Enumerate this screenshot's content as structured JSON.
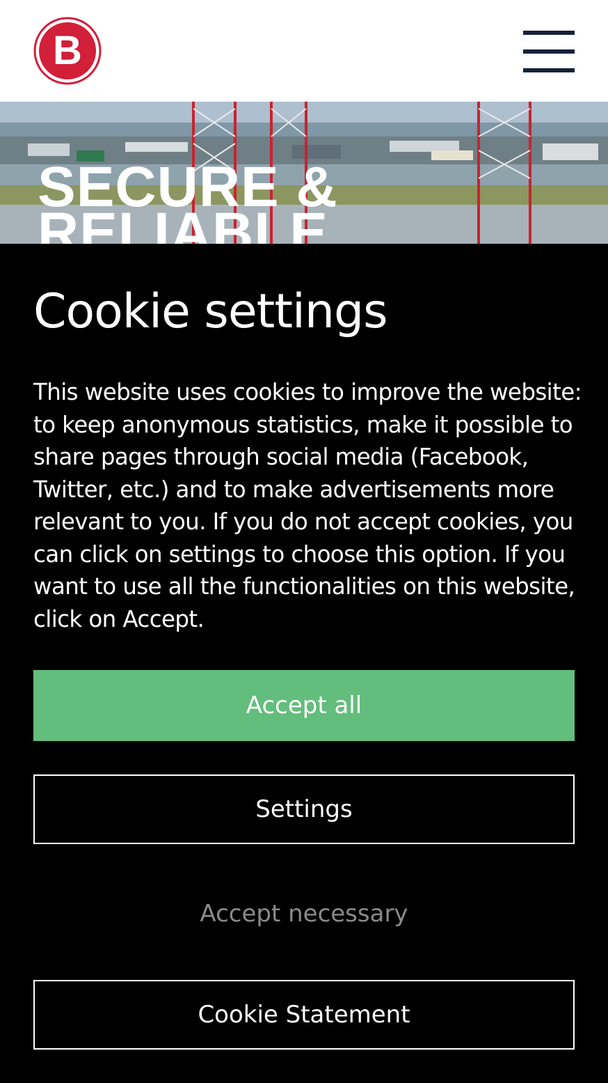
{
  "header": {
    "logo_letter": "B",
    "logo_colors": {
      "ring": "#d21f3a",
      "fill": "#d21f3a",
      "letter": "#ffffff"
    },
    "menu_icon": "hamburger-icon",
    "menu_color": "#16213a"
  },
  "hero": {
    "title_line1": "SECURE &",
    "title_line2": "RELIABLE"
  },
  "cookie": {
    "title": "Cookie settings",
    "text": "This website uses cookies to improve the website: to keep anonymous statistics, make it possible to share pages through social media (Facebook, Twitter, etc.) and to make advertisements more relevant to you. If you do not accept cookies, you can click on settings to choose this option. If you want to use all the functionalities on this website, click on Accept.",
    "accept_all": "Accept all",
    "settings": "Settings",
    "accept_necessary": "Accept necessary",
    "cookie_statement": "Cookie Statement",
    "accent_color": "#63bd7c"
  }
}
